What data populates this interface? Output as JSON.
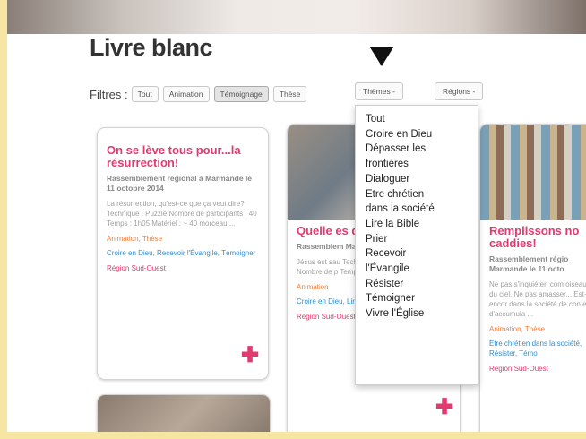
{
  "page_title": "Livre blanc",
  "filters": {
    "label": "Filtres :",
    "buttons": [
      "Tout",
      "Animation",
      "Témoignage",
      "Thèse"
    ],
    "active": "Témoignage",
    "themes_label": "Thèmes -",
    "regions_label": "Régions -"
  },
  "themes_menu": [
    "Tout",
    "Croire en Dieu",
    "Dépasser les",
    "frontières",
    "Dialoguer",
    "Etre chrétien",
    "dans la société",
    "Lire la Bible",
    "Prier",
    "Recevoir",
    "l'Évangile",
    "Résister",
    "Témoigner",
    "Vivre l'Église"
  ],
  "cards": [
    {
      "title": "On se lève tous pour...la résurrection!",
      "meta": "Rassemblement régional à Marmande le 11 octobre 2014",
      "desc": "La résurrection, qu'est-ce que ça veut dire? Technique : Puzzle Nombre de participants : 40 Temps : 1h05 Matériel : ~ 40 morceau ...",
      "cats": "Animation, Thèse",
      "tags": "Croire en Dieu, Recevoir l'Évangile, Témoigner",
      "region": "Région Sud-Ouest"
    },
    {
      "title": "Quelle es de salut?",
      "meta": "Rassemblem Marmande l",
      "desc": "Jésus est sau Technique : C groupes, en j Nombre de p Temps : 1h05",
      "cats": "Animation",
      "tags": "Croire en Dieu, Lire la Bible, Témoigner",
      "region": "Région Sud-Ouest"
    },
    {
      "title": "Remplissons no caddies!",
      "meta": "Rassemblement régio Marmande le 11 octo",
      "desc": "Ne pas s'inquiéter, com oiseaux du ciel. Ne pas amasser....Est-ce encor dans la société de con et d'accumula ...",
      "cats": "Animation, Thèse",
      "tags": "Être chrétien dans la société, Résister, Témo",
      "region": "Région Sud-Ouest"
    }
  ],
  "plus_symbol": "✚"
}
